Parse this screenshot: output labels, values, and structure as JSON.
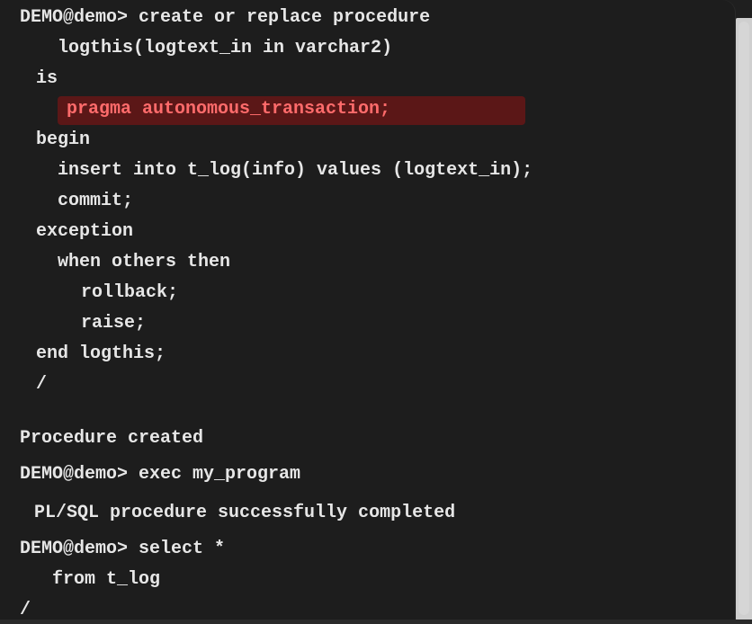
{
  "terminal": {
    "lines": [
      {
        "text": "DEMO@demo> create or replace procedure"
      },
      {
        "text": "  logthis(logtext_in in varchar2)"
      },
      {
        "text": " is"
      },
      {
        "text": "  pragma autonomous_transaction;"
      },
      {
        "text": " begin"
      },
      {
        "text": "  insert into t_log(info) values (logtext_in);"
      },
      {
        "text": "  commit;"
      },
      {
        "text": " exception"
      },
      {
        "text": "  when others then"
      },
      {
        "text": "   rollback;"
      },
      {
        "text": "   raise;"
      },
      {
        "text": " end logthis;"
      },
      {
        "text": " /"
      },
      {
        "text": "Procedure created"
      },
      {
        "text": "DEMO@demo> exec my_program"
      },
      {
        "text": " PL/SQL procedure successfully completed"
      },
      {
        "text": "DEMO@demo> select *"
      },
      {
        "text": "  from t_log"
      },
      {
        "text": "/"
      }
    ]
  },
  "colors": {
    "background": "#1d1d1d",
    "text": "#e6e6e6",
    "highlight_bg": "#5b1717",
    "highlight_text": "#ff6b6b"
  }
}
